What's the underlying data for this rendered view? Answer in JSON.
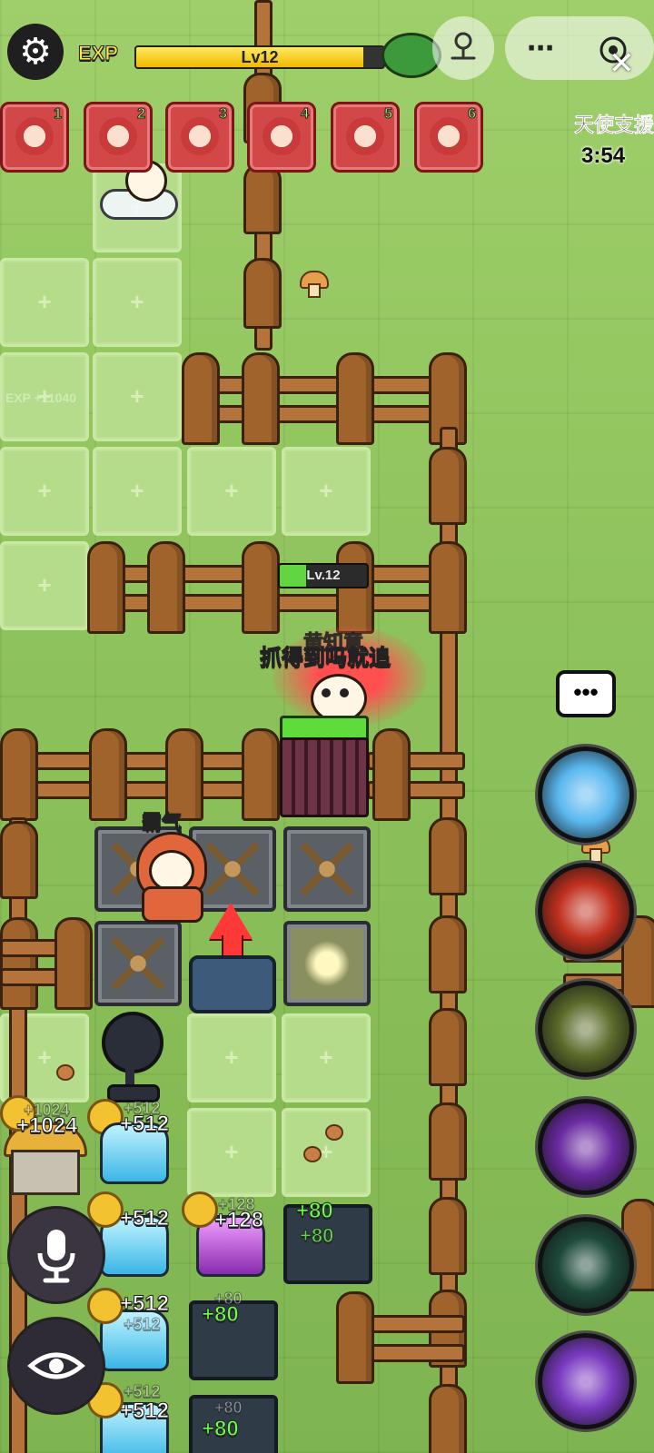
{
  "hud": {
    "exp_label": "EXP",
    "level_text": "Lv12",
    "exp_progress": 0.92,
    "settings_icon": "gear-icon",
    "joystick_icon": "joystick-icon",
    "more_icon": "more-icon",
    "close_icon": "close-icon",
    "target_icon": "target-icon"
  },
  "skill_slots": [
    {
      "num": "1",
      "icon": "claw-icon"
    },
    {
      "num": "2",
      "icon": "sheep-hood-icon"
    },
    {
      "num": "3",
      "icon": "fire-claw-icon"
    },
    {
      "num": "4",
      "icon": "purple-claw-icon"
    },
    {
      "num": "5",
      "icon": "claw-icon"
    },
    {
      "num": "6",
      "icon": "claw-icon"
    }
  ],
  "side": {
    "title": "天使支援",
    "timer": "3:54"
  },
  "floating": {
    "exp_gain": "EXP +11040"
  },
  "enemy": {
    "level": "Lv.12",
    "name": "黄知意",
    "speech": "抓得到吗就追"
  },
  "player": {
    "label": "霸气"
  },
  "resources": [
    {
      "text": "+1024",
      "ghost": "+1024"
    },
    {
      "text": "+512",
      "ghost": "+512"
    },
    {
      "text": "+512",
      "ghost": "+512"
    },
    {
      "text": "+128",
      "ghost": "+128"
    },
    {
      "text": "+80",
      "ghost": "+80"
    },
    {
      "text": "+512",
      "ghost": "+512"
    },
    {
      "text": "+80",
      "ghost": "+80"
    },
    {
      "text": "+512",
      "ghost": "+512"
    },
    {
      "text": "+80",
      "ghost": "+80"
    }
  ],
  "right_skills": [
    {
      "icon": "ice-blast-skill-icon",
      "color": "#5ab8f0"
    },
    {
      "icon": "rage-face-skill-icon",
      "color": "#c0301e"
    },
    {
      "icon": "lightning-figure-skill-icon",
      "color": "#5a6a2a"
    },
    {
      "icon": "shadow-wolf-skill-icon",
      "color": "#6a2aa0"
    },
    {
      "icon": "shield-skill-icon",
      "color": "#1e4a3a"
    },
    {
      "icon": "dark-monster-skill-icon",
      "color": "#7a3ac0"
    }
  ],
  "controls": {
    "chat_icon": "chat-icon",
    "mic_icon": "microphone-icon",
    "eye_icon": "eye-icon"
  }
}
